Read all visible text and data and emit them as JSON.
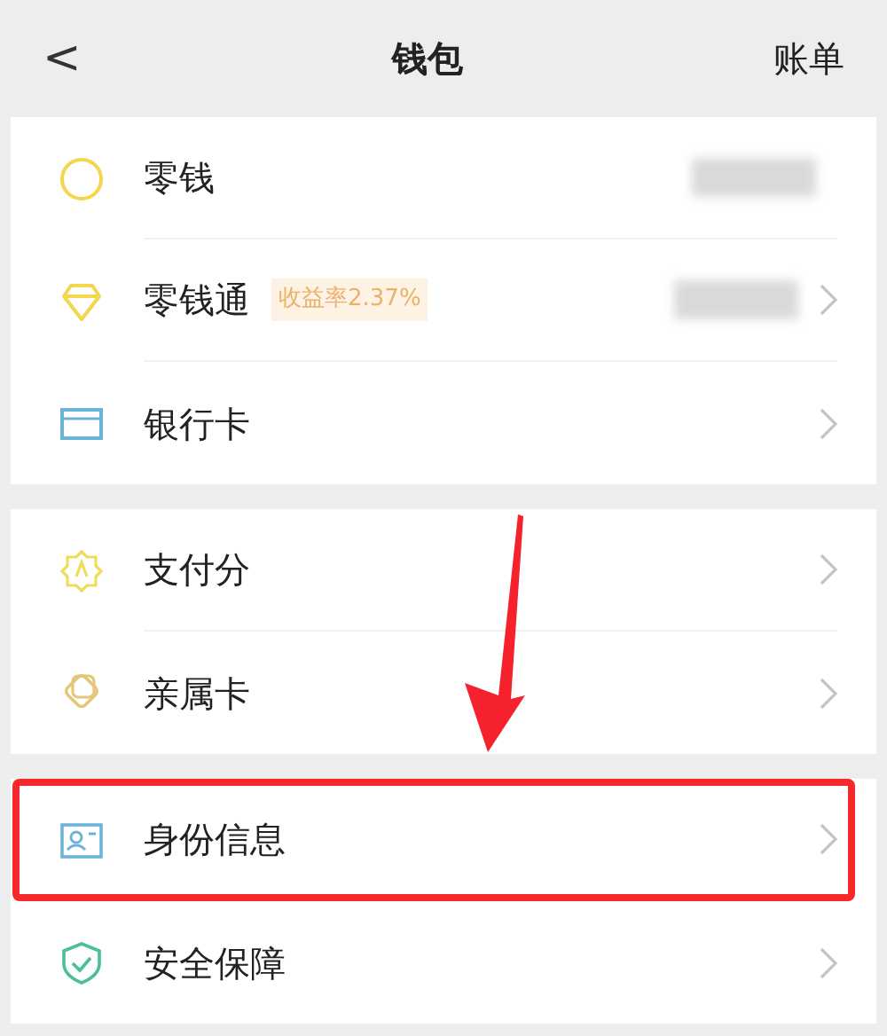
{
  "header": {
    "back": "<",
    "title": "钱包",
    "action": "账单"
  },
  "groups": [
    {
      "rows": [
        {
          "label": "零钱",
          "amount_redacted": true,
          "chevron": false,
          "highlighted": false
        },
        {
          "label": "零钱通",
          "badge": "收益率2.37%",
          "amount_redacted": true,
          "chevron": true,
          "highlighted": false
        },
        {
          "label": "银行卡",
          "amount_redacted": false,
          "chevron": true,
          "highlighted": false
        }
      ]
    },
    {
      "rows": [
        {
          "label": "支付分",
          "amount_redacted": false,
          "chevron": true,
          "highlighted": false
        },
        {
          "label": "亲属卡",
          "amount_redacted": false,
          "chevron": true,
          "highlighted": false
        }
      ]
    },
    {
      "rows": [
        {
          "label": "身份信息",
          "amount_redacted": false,
          "chevron": true,
          "highlighted": true
        },
        {
          "label": "安全保障",
          "amount_redacted": false,
          "chevron": true,
          "highlighted": false
        }
      ]
    }
  ],
  "annotation": {
    "arrow": true
  }
}
